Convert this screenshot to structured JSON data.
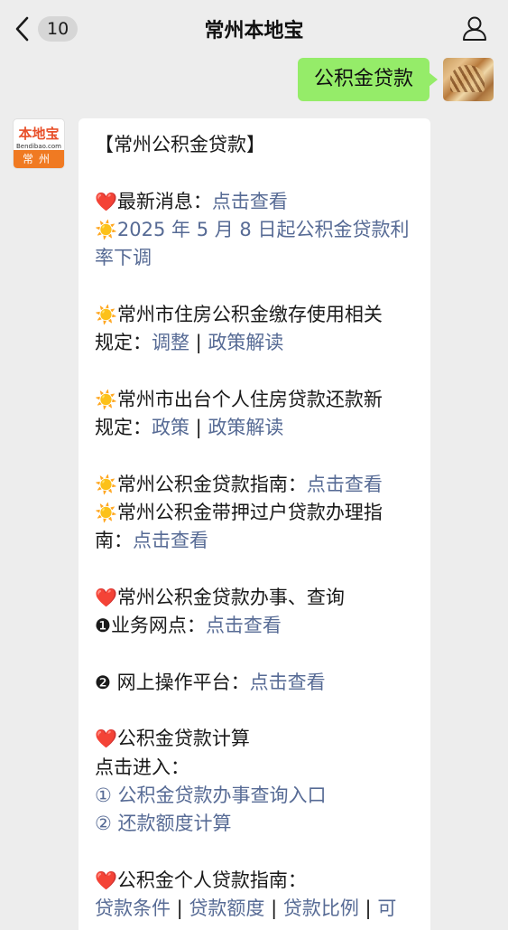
{
  "header": {
    "unread_count": "10",
    "title": "常州本地宝",
    "icons": {
      "back": "chevron-left-icon",
      "profile": "user-icon"
    }
  },
  "sent_message": {
    "text": "公积金贷款"
  },
  "bot": {
    "logo_text": "本地宝",
    "logo_sub": "Bendibao.com",
    "logo_city": "常州"
  },
  "reply": {
    "heading": "【常州公积金贷款】",
    "s1_label": "最新消息：",
    "s1_link": "点击查看",
    "s1_news_1": "2025 年 5 月 8 日起公积金贷款利",
    "s1_news_2": "率下调",
    "s2_text_1": "常州市住房公积金缴存使用相关",
    "s2_text_2": "规定：",
    "s2_link_1": "调整",
    "s2_sep": " | ",
    "s2_link_2": "政策解读",
    "s3_text_1": "常州市出台个人住房贷款还款新",
    "s3_text_2": "规定：",
    "s3_link_1": "政策",
    "s3_sep": " | ",
    "s3_link_2": "政策解读",
    "s4_text": "常州公积金贷款指南：",
    "s4_link": "点击查看",
    "s5_text_1": "常州公积金带押过户贷款办理指",
    "s5_text_2": "南：",
    "s5_link": "点击查看",
    "s6_heading": "常州公积金贷款办事、查询",
    "s6_item1_num": "❶",
    "s6_item1_label": "业务网点：",
    "s6_item1_link": "点击查看",
    "s6_item2_num": "❷",
    "s6_item2_label": " 网上操作平台：",
    "s6_item2_link": "点击查看",
    "s7_heading": "公积金贷款计算",
    "s7_enter": "点击进入：",
    "s7_item1_num": "①",
    "s7_item1_link": "公积金贷款办事查询入口",
    "s7_item2_num": "②",
    "s7_item2_link": "还款额度计算",
    "s8_heading": "公积金个人贷款指南：",
    "s8_link_1": "贷款条件",
    "s8_link_2": "贷款额度",
    "s8_link_3": "贷款比例",
    "s8_link_4": "可",
    "s8_sep": " | ",
    "emoji_heart": "❤️",
    "emoji_sun": "☀️"
  },
  "colors": {
    "bg": "#ededed",
    "sent_bubble": "#95ec69",
    "link": "#576b95",
    "badge": "#d6d6d6",
    "logo_orange": "#f07a22"
  }
}
